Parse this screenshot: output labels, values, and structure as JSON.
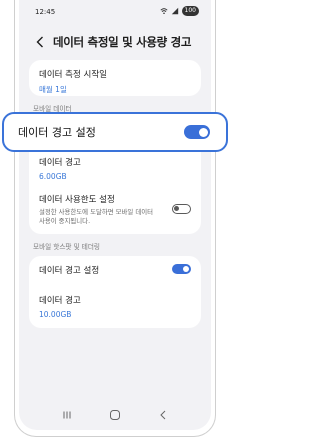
{
  "status_bar": {
    "time": "12:45",
    "battery": "100"
  },
  "header": {
    "title": "데이터 측정일 및 사용량 경고"
  },
  "measure_card": {
    "title": "데이터 측정 시작일",
    "value": "매월 1일"
  },
  "mobile_data_section": {
    "label": "모바일 데이터"
  },
  "callout": {
    "label": "데이터 경고 설정",
    "toggle_on": true
  },
  "mobile_card": {
    "warning_title": "데이터 경고",
    "warning_value": "6.00GB",
    "limit_title": "데이터 사용한도 설정",
    "limit_desc_line1": "설정한 사용한도에 도달하면 모바일 데이터",
    "limit_desc_line2": "사용이 중지됩니다.",
    "limit_toggle_on": false
  },
  "hotspot_section": {
    "label": "모바일 핫스팟 및 테더링"
  },
  "hotspot_card": {
    "warning_setting_title": "데이터 경고 설정",
    "warning_setting_on": true,
    "warning_title": "데이터 경고",
    "warning_value": "10.00GB"
  },
  "colors": {
    "accent": "#3a6fd8",
    "background": "#f2f2f5",
    "card": "#ffffff"
  },
  "icons": [
    "back-arrow-icon",
    "wifi-icon",
    "signal-icon",
    "battery-icon",
    "recents-icon",
    "home-icon",
    "nav-back-icon"
  ]
}
